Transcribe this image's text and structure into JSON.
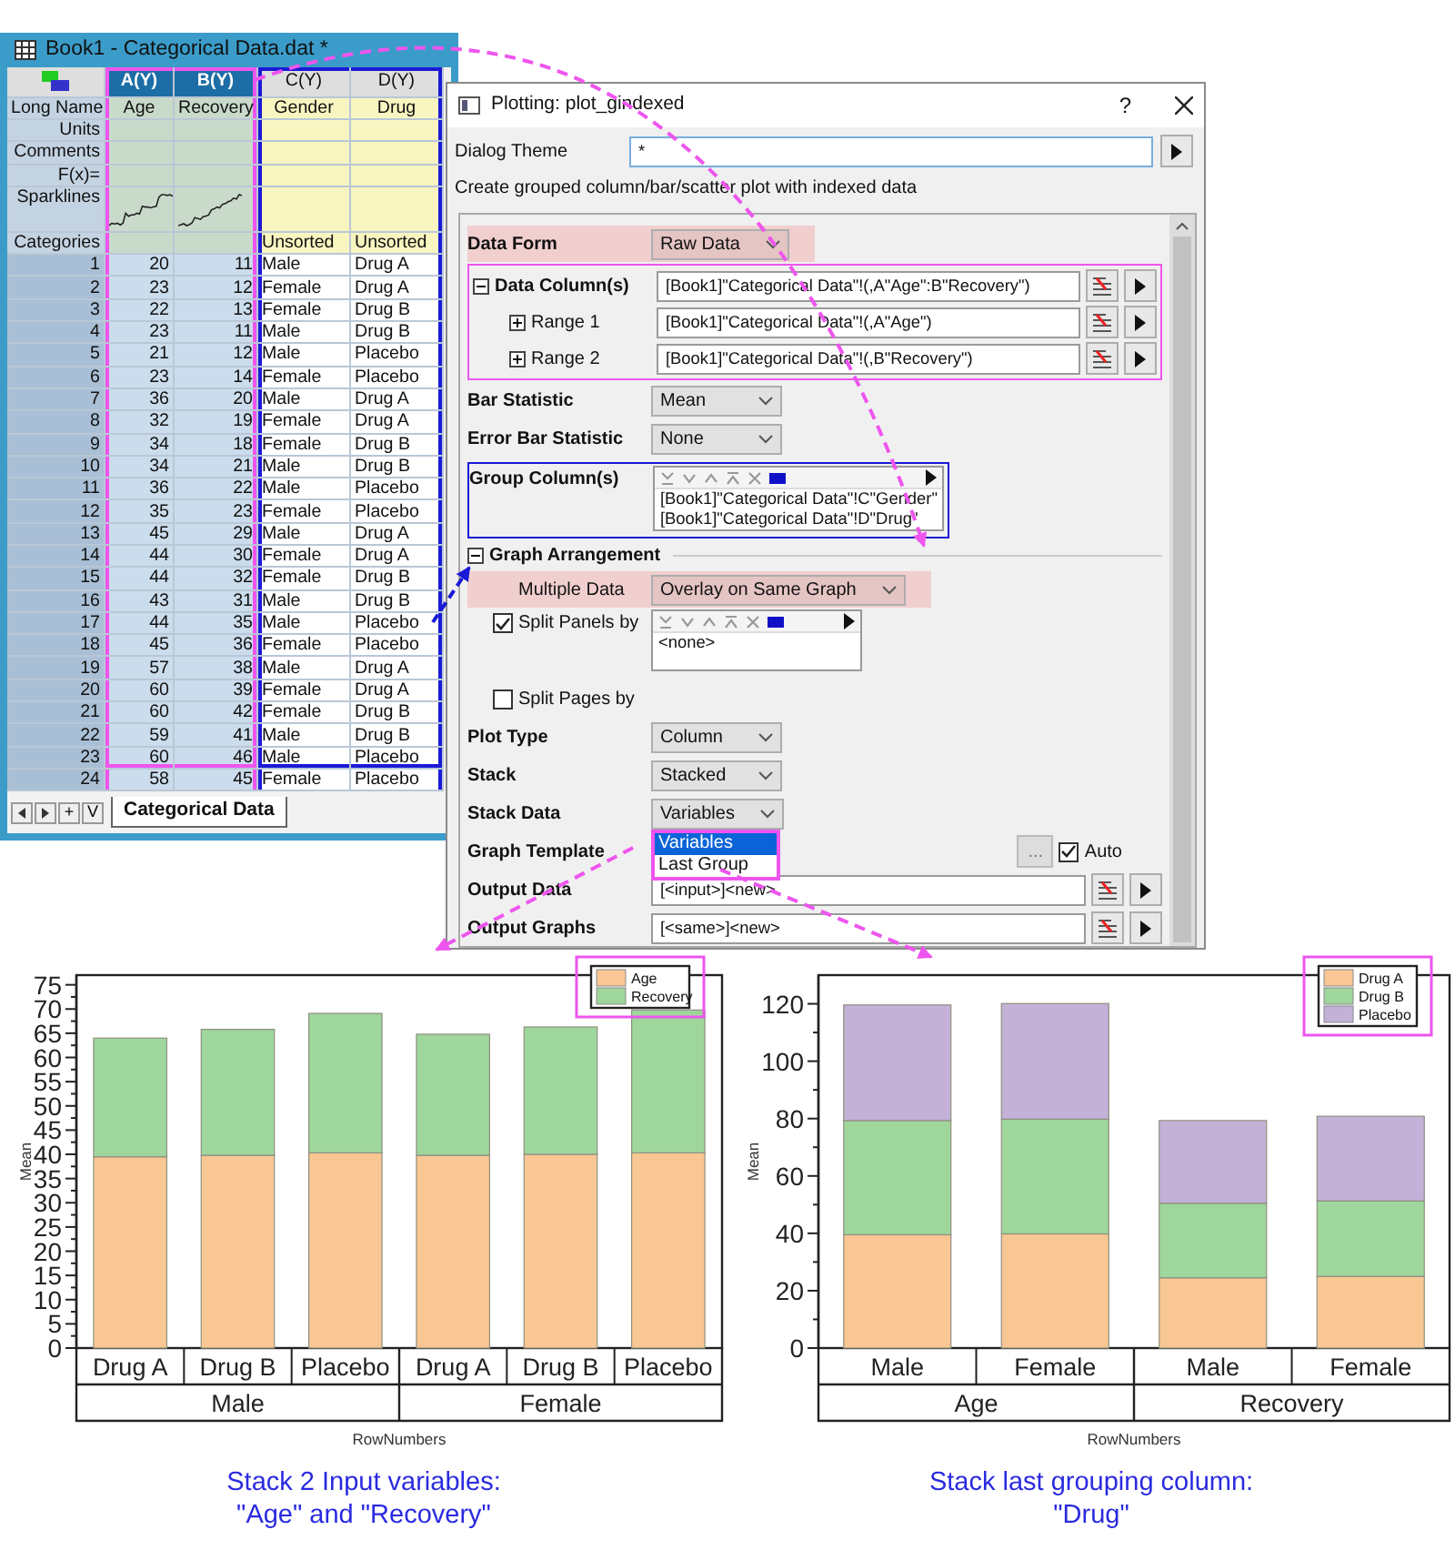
{
  "worksheet": {
    "title": "Book1 - Categorical Data.dat *",
    "columns": [
      {
        "header": "A(Y)",
        "long_name": "Age",
        "kind": "numeric",
        "selected": true,
        "sparkline": true,
        "color": "#ee55ee"
      },
      {
        "header": "B(Y)",
        "long_name": "Recovery",
        "kind": "numeric",
        "selected": true,
        "sparkline": true,
        "color": "#ee55ee"
      },
      {
        "header": "C(Y)",
        "long_name": "Gender",
        "kind": "text",
        "selected": false,
        "sparkline": false,
        "categories": "Unsorted",
        "color": "#1a1ad6"
      },
      {
        "header": "D(Y)",
        "long_name": "Drug",
        "kind": "text",
        "selected": false,
        "sparkline": false,
        "categories": "Unsorted",
        "color": "#1a1ad6"
      }
    ],
    "row_labels": [
      "Long Name",
      "Units",
      "Comments",
      "F(x)=",
      "Sparklines",
      "Categories"
    ],
    "rows": [
      {
        "number": "1",
        "cells": [
          "20",
          "11",
          "Male",
          "Drug A"
        ]
      },
      {
        "number": "2",
        "cells": [
          "23",
          "12",
          "Female",
          "Drug A"
        ]
      },
      {
        "number": "3",
        "cells": [
          "22",
          "13",
          "Female",
          "Drug B"
        ]
      },
      {
        "number": "4",
        "cells": [
          "23",
          "11",
          "Male",
          "Drug B"
        ]
      },
      {
        "number": "5",
        "cells": [
          "21",
          "12",
          "Male",
          "Placebo"
        ]
      },
      {
        "number": "6",
        "cells": [
          "23",
          "14",
          "Female",
          "Placebo"
        ]
      },
      {
        "number": "7",
        "cells": [
          "36",
          "20",
          "Male",
          "Drug A"
        ]
      },
      {
        "number": "8",
        "cells": [
          "32",
          "19",
          "Female",
          "Drug A"
        ]
      },
      {
        "number": "9",
        "cells": [
          "34",
          "18",
          "Female",
          "Drug B"
        ]
      },
      {
        "number": "10",
        "cells": [
          "34",
          "21",
          "Male",
          "Drug B"
        ]
      },
      {
        "number": "11",
        "cells": [
          "36",
          "22",
          "Male",
          "Placebo"
        ]
      },
      {
        "number": "12",
        "cells": [
          "35",
          "23",
          "Female",
          "Placebo"
        ]
      },
      {
        "number": "13",
        "cells": [
          "45",
          "29",
          "Male",
          "Drug A"
        ]
      },
      {
        "number": "14",
        "cells": [
          "44",
          "30",
          "Female",
          "Drug A"
        ]
      },
      {
        "number": "15",
        "cells": [
          "44",
          "32",
          "Female",
          "Drug B"
        ]
      },
      {
        "number": "16",
        "cells": [
          "43",
          "31",
          "Male",
          "Drug B"
        ]
      },
      {
        "number": "17",
        "cells": [
          "44",
          "35",
          "Male",
          "Placebo"
        ]
      },
      {
        "number": "18",
        "cells": [
          "45",
          "36",
          "Female",
          "Placebo"
        ]
      },
      {
        "number": "19",
        "cells": [
          "57",
          "38",
          "Male",
          "Drug A"
        ]
      },
      {
        "number": "20",
        "cells": [
          "60",
          "39",
          "Female",
          "Drug A"
        ]
      },
      {
        "number": "21",
        "cells": [
          "60",
          "42",
          "Female",
          "Drug B"
        ]
      },
      {
        "number": "22",
        "cells": [
          "59",
          "41",
          "Male",
          "Drug B"
        ]
      },
      {
        "number": "23",
        "cells": [
          "60",
          "46",
          "Male",
          "Placebo"
        ]
      },
      {
        "number": "24",
        "cells": [
          "58",
          "45",
          "Female",
          "Placebo"
        ]
      }
    ],
    "nav_buttons": [
      "+",
      "V"
    ],
    "sheet_tabs": [
      {
        "label": "Categorical Data",
        "selected": true
      }
    ]
  },
  "dialog": {
    "title": "Plotting: plot_gindexed",
    "help": "?",
    "theme_label": "Dialog Theme",
    "theme_value": "*",
    "description": "Create grouped column/bar/scatter plot with indexed data",
    "fields": [
      {
        "kind": "select",
        "label": "Data Form",
        "value": "Raw Data",
        "highlighted": true
      },
      {
        "kind": "range",
        "label": "Data Column(s)",
        "value": "[Book1]\"Categorical Data\"!(,A\"Age\":B\"Recovery\")",
        "expanded": true,
        "color": "#ee55ee",
        "children": [
          {
            "kind": "range",
            "label": "Range 1",
            "value": "[Book1]\"Categorical Data\"!(,A\"Age\")",
            "expanded": false
          },
          {
            "kind": "range",
            "label": "Range 2",
            "value": "[Book1]\"Categorical Data\"!(,B\"Recovery\")",
            "expanded": false
          }
        ]
      },
      {
        "kind": "select",
        "label": "Bar Statistic",
        "value": "Mean",
        "highlighted": false
      },
      {
        "kind": "select",
        "label": "Error Bar Statistic",
        "value": "None",
        "highlighted": false
      },
      {
        "kind": "list",
        "label": "Group Column(s)",
        "color": "#1a1ad6",
        "entries": [
          "[Book1]\"Categorical Data\"!C\"Gender\"",
          "[Book1]\"Categorical Data\"!D\"Drug\""
        ]
      },
      {
        "kind": "section",
        "label": "Graph Arrangement",
        "expanded": true,
        "children": [
          {
            "kind": "select",
            "label": "Multiple Data",
            "value": "Overlay on Same Graph",
            "highlighted": true
          },
          {
            "kind": "checklist",
            "label": "Split Panels by",
            "checked": true,
            "entries": [
              "<none>"
            ]
          },
          {
            "kind": "checkbox",
            "label": "Split Pages by",
            "checked": false
          }
        ]
      },
      {
        "kind": "select",
        "label": "Plot Type",
        "value": "Column",
        "highlighted": false
      },
      {
        "kind": "select",
        "label": "Stack",
        "value": "Stacked",
        "highlighted": false
      },
      {
        "kind": "select",
        "label": "Stack Data",
        "value": "Variables",
        "highlighted": false,
        "expanded": true,
        "options": [
          {
            "label": "Variables",
            "selected": true
          },
          {
            "label": "Last Group",
            "selected": false
          }
        ]
      },
      {
        "kind": "template",
        "label": "Graph Template",
        "button": "...",
        "auto_label": "Auto",
        "auto_checked": true
      },
      {
        "kind": "range",
        "label": "Output Data",
        "value": "[<input>]<new>"
      },
      {
        "kind": "range",
        "label": "Output Graphs",
        "value": "[<same>]<new>"
      }
    ]
  },
  "charts": [
    {
      "legend_highlighted": true,
      "group_labels": [
        "Male",
        "Female"
      ],
      "caption": "Stack 2 Input variables:\n\"Age\" and \"Recovery\"",
      "chart_data": {
        "type": "bar",
        "stacked": true,
        "xlabel": "RowNumbers",
        "ylabel": "Mean",
        "legend": true,
        "categories": [
          "Drug A",
          "Drug B",
          "Placebo",
          "Drug A",
          "Drug B",
          "Placebo"
        ],
        "series": [
          {
            "name": "Age",
            "color": "#f9c794",
            "values": [
              39.5,
              39.8,
              40.3,
              39.8,
              40,
              40.3
            ]
          },
          {
            "name": "Recovery",
            "color": "#9fd69c",
            "values": [
              24.5,
              26,
              28.8,
              25,
              26.3,
              29.5
            ]
          }
        ],
        "ylim": [
          0,
          77
        ],
        "yticks": [
          0,
          5,
          10,
          15,
          20,
          25,
          30,
          35,
          40,
          45,
          50,
          55,
          60,
          65,
          70,
          75
        ]
      }
    },
    {
      "legend_highlighted": true,
      "group_labels": [
        "Age",
        "Recovery"
      ],
      "caption": "Stack last grouping column:\n\"Drug\"",
      "chart_data": {
        "type": "bar",
        "stacked": true,
        "xlabel": "RowNumbers",
        "ylabel": "Mean",
        "legend": true,
        "categories": [
          "Male",
          "Female",
          "Male",
          "Female"
        ],
        "series": [
          {
            "name": "Drug A",
            "color": "#f9c794",
            "values": [
              39.5,
              39.8,
              24.5,
              25
            ]
          },
          {
            "name": "Drug B",
            "color": "#9fd69c",
            "values": [
              39.8,
              40,
              26,
              26.3
            ]
          },
          {
            "name": "Placebo",
            "color": "#c3b1d7",
            "values": [
              40.3,
              40.3,
              28.8,
              29.5
            ]
          }
        ],
        "ylim": [
          0,
          130
        ],
        "yticks": [
          0,
          20,
          40,
          60,
          80,
          100,
          120
        ]
      }
    }
  ]
}
